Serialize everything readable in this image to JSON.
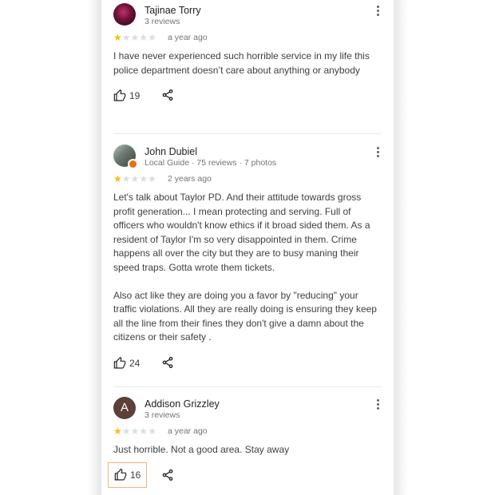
{
  "reviews": [
    {
      "name": "Tajinae Torry",
      "meta": "3 reviews",
      "rating": 1,
      "date": "a year ago",
      "text": "I have never experienced such horrible service in my life this police department doesn’t care about anything or anybody",
      "likes": "19"
    },
    {
      "name": "John Dubiel",
      "meta": "Local Guide · 75 reviews · 7 photos",
      "rating": 1,
      "date": "2 years ago",
      "text": "Let's talk about Taylor PD. And their attitude towards gross profit generation... I mean protecting and serving. Full of officers who wouldn't know ethics if it broad sided them. As a resident of Taylor I'm so very disappointed in them. Crime happens all over the city but they are to busy maning their speed traps. Gotta wrote them tickets.\n\nAlso act like they are doing you a favor by \"reducing\" your traffic violations. All they are really doing is ensuring they keep all the line from their fines they don't give a damn about the citizens or their safety .",
      "likes": "24"
    },
    {
      "name": "Addison Grizzley",
      "avatar_letter": "A",
      "meta": "3 reviews",
      "rating": 1,
      "date": "a year ago",
      "text": "Just horrible. Not a good area. Stay away",
      "likes": "16"
    }
  ],
  "icons": {
    "like": "thumb-up-icon",
    "share": "share-icon",
    "menu": "more-vert-icon"
  },
  "colors": {
    "star_filled": "#fbbc04",
    "star_empty": "#dadce0",
    "selection_outline": "#f6b26b"
  }
}
